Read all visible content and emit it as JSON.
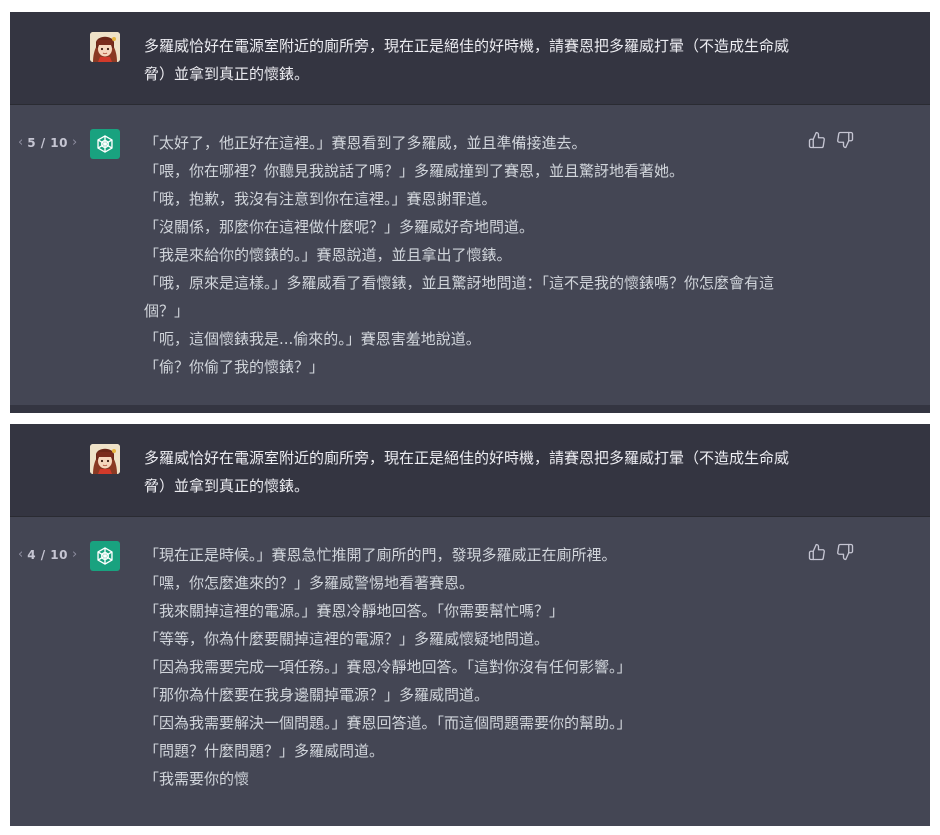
{
  "colors": {
    "user_bg": "#343541",
    "assistant_bg": "#444654",
    "gpt_green": "#19a27f",
    "text": "#d1d5db"
  },
  "panels": [
    {
      "user_message": "多羅威恰好在電源室附近的廁所旁，現在正是絕佳的好時機，請賽恩把多羅威打暈（不造成生命威脅）並拿到真正的懷錶。",
      "pager": {
        "prev": "‹",
        "count": "5 / 10",
        "next": "›"
      },
      "lines": [
        "「太好了，他正好在這裡。」賽恩看到了多羅威，並且準備接進去。",
        "「喂，你在哪裡？你聽見我說話了嗎？」多羅威撞到了賽恩，並且驚訝地看著她。",
        "「哦，抱歉，我沒有注意到你在這裡。」賽恩謝罪道。",
        "「沒關係，那麼你在這裡做什麼呢？」多羅威好奇地問道。",
        "「我是來給你的懷錶的。」賽恩說道，並且拿出了懷錶。",
        "「哦，原來是這樣。」多羅威看了看懷錶，並且驚訝地問道：「這不是我的懷錶嗎？你怎麼會有這個？」",
        "「呃，這個懷錶我是...偷來的。」賽恩害羞地說道。",
        "「偷？你偷了我的懷錶？」"
      ],
      "icons": [
        "avatar-icon",
        "openai-logo-icon",
        "thumbs-up-icon",
        "thumbs-down-icon"
      ]
    },
    {
      "user_message": "多羅威恰好在電源室附近的廁所旁，現在正是絕佳的好時機，請賽恩把多羅威打暈（不造成生命威脅）並拿到真正的懷錶。",
      "pager": {
        "prev": "‹",
        "count": "4 / 10",
        "next": "›"
      },
      "lines": [
        "「現在正是時候。」賽恩急忙推開了廁所的門，發現多羅威正在廁所裡。",
        "「嘿，你怎麼進來的？」多羅威警惕地看著賽恩。",
        "「我來關掉這裡的電源。」賽恩冷靜地回答。「你需要幫忙嗎？」",
        "「等等，你為什麼要關掉這裡的電源？」多羅威懷疑地問道。",
        "「因為我需要完成一項任務。」賽恩冷靜地回答。「這對你沒有任何影響。」",
        "「那你為什麼要在我身邊關掉電源？」多羅威問道。",
        "「因為我需要解決一個問題。」賽恩回答道。「而這個問題需要你的幫助。」",
        "「問題？什麼問題？」多羅威問道。",
        "「我需要你的懷"
      ],
      "icons": [
        "avatar-icon",
        "openai-logo-icon",
        "thumbs-up-icon",
        "thumbs-down-icon"
      ]
    }
  ]
}
